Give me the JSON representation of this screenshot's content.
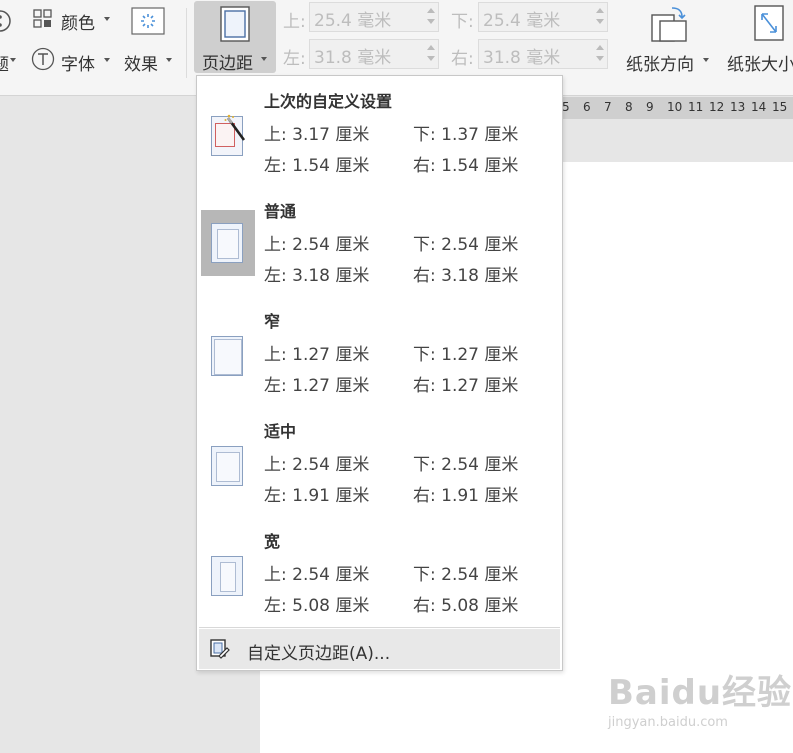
{
  "ribbon": {
    "partial_left_label": "题",
    "color_label": "颜色",
    "font_label": "字体",
    "effect_label": "效果",
    "margins_label": "页边距",
    "top_label": "上:",
    "top_value": "25.4 毫米",
    "bottom_label": "下:",
    "bottom_value": "25.4 毫米",
    "left_label": "左:",
    "left_value": "31.8 毫米",
    "right_label": "右:",
    "right_value": "31.8 毫米",
    "orientation_label": "纸张方向",
    "size_label": "纸张大小"
  },
  "ruler": {
    "ticks": [
      "5",
      "6",
      "7",
      "8",
      "9",
      "10",
      "11",
      "12",
      "13",
      "14",
      "15",
      "16"
    ]
  },
  "menu": {
    "presets": [
      {
        "name": "上次的自定义设置",
        "top": "上: 3.17 厘米",
        "bottom": "下: 1.37 厘米",
        "left": "左: 1.54 厘米",
        "right": "右: 1.54 厘米"
      },
      {
        "name": "普通",
        "top": "上: 2.54 厘米",
        "bottom": "下: 2.54 厘米",
        "left": "左: 3.18 厘米",
        "right": "右: 3.18 厘米"
      },
      {
        "name": "窄",
        "top": "上: 1.27 厘米",
        "bottom": "下: 1.27 厘米",
        "left": "左: 1.27 厘米",
        "right": "右: 1.27 厘米"
      },
      {
        "name": "适中",
        "top": "上: 2.54 厘米",
        "bottom": "下: 2.54 厘米",
        "left": "左: 1.91 厘米",
        "right": "右: 1.91 厘米"
      },
      {
        "name": "宽",
        "top": "上: 2.54 厘米",
        "bottom": "下: 2.54 厘米",
        "left": "左: 5.08 厘米",
        "right": "右: 5.08 厘米"
      }
    ],
    "custom_label": "自定义页边距(A)..."
  },
  "watermark": {
    "brand": "Baidu经验",
    "url": "jingyan.baidu.com"
  },
  "colors": {
    "accent": "#4a6fa5",
    "selected_bg": "#b7b7b7",
    "hover_bg": "#e8e8e8"
  }
}
